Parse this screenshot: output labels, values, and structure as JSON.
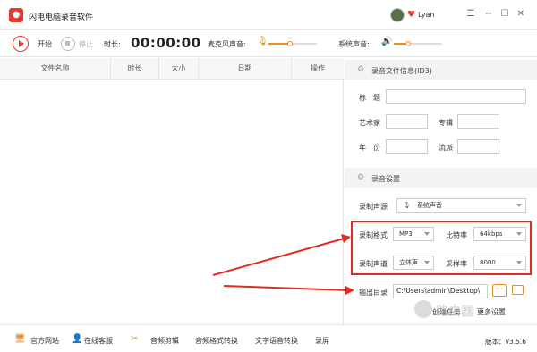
{
  "app": {
    "title": "闪电电脑录音软件",
    "logo_icon": "microphone-icon"
  },
  "user": {
    "name": "Lyan"
  },
  "window": {
    "menu_glyph": "☰",
    "min_glyph": "−",
    "max_glyph": "☐",
    "close_glyph": "✕"
  },
  "toolbar": {
    "start_label": "开始",
    "stop_label": "停止",
    "duration_label": "时长:",
    "duration_value": "00:00:00",
    "mic_label": "麦克风声音:",
    "system_label": "系统声音:",
    "mic_level": 0.45,
    "system_level": 0.3
  },
  "file_list": {
    "columns": [
      "文件名称",
      "时长",
      "大小",
      "日期",
      "操作"
    ]
  },
  "id3": {
    "section_title": "录音文件信息(ID3)",
    "title_label": "标　题",
    "artist_label": "艺术家",
    "album_label": "专辑",
    "year_label": "年　份",
    "genre_label": "流派"
  },
  "settings": {
    "section_title": "录音设置",
    "source_label": "录制声源",
    "source_value": "系统声音",
    "format_label": "录制格式",
    "format_value": "MP3",
    "bitrate_label": "比特率",
    "bitrate_value": "64kbps",
    "channel_label": "录制声道",
    "channel_value": "立体声",
    "samplerate_label": "采样率",
    "samplerate_value": "8000",
    "output_label": "输出目录",
    "output_value": "C:\\Users\\admin\\Desktop\\"
  },
  "links": {
    "task": "创建任务",
    "more": "更多设置"
  },
  "bottom": {
    "website": "官方网站",
    "support": "在线客服",
    "audio_cut": "音频剪辑",
    "format_convert": "音频格式转换",
    "tts": "文字语音转换",
    "record_screen": "录屏",
    "version": "版本：v3.5.6"
  },
  "colors": {
    "accent": "#f08a24",
    "brand": "#e33a2c",
    "highlight": "#e32a1f"
  }
}
